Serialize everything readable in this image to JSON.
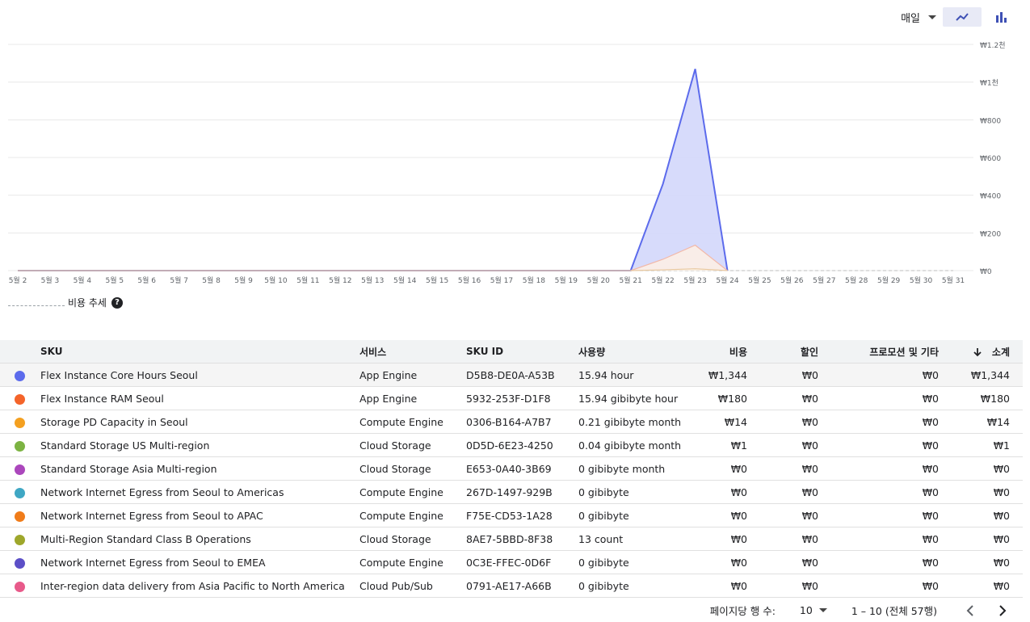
{
  "toolbar": {
    "granularity": "매일",
    "line_icon": "line-chart-icon",
    "bar_icon": "bar-chart-icon"
  },
  "legend": {
    "trend_label": "비용 추세",
    "help": "?"
  },
  "chart_data": {
    "type": "area",
    "x": [
      "5월 2",
      "5월 3",
      "5월 4",
      "5월 5",
      "5월 6",
      "5월 7",
      "5월 8",
      "5월 9",
      "5월 10",
      "5월 11",
      "5월 12",
      "5월 13",
      "5월 14",
      "5월 15",
      "5월 16",
      "5월 17",
      "5월 18",
      "5월 19",
      "5월 20",
      "5월 21",
      "5월 22",
      "5월 23",
      "5월 24",
      "5월 25",
      "5월 26",
      "5월 27",
      "5월 28",
      "5월 29",
      "5월 30",
      "5월 31"
    ],
    "y_ticks": [
      "₩0",
      "₩200",
      "₩400",
      "₩600",
      "₩800",
      "₩1천",
      "₩1.2천"
    ],
    "ylim": [
      0,
      1200
    ],
    "grid": true,
    "series": [
      {
        "values": [
          0,
          0,
          0,
          0,
          0,
          0,
          0,
          0,
          0,
          0,
          0,
          0,
          0,
          0,
          0,
          0,
          0,
          0,
          0,
          0,
          460,
          1070,
          0,
          null,
          null,
          null,
          null,
          null,
          null,
          null
        ],
        "color": "#5c6bec",
        "fill": "#d3d7fb"
      },
      {
        "values": [
          0,
          0,
          0,
          0,
          0,
          0,
          0,
          0,
          0,
          0,
          0,
          0,
          0,
          0,
          0,
          0,
          0,
          0,
          0,
          0,
          60,
          135,
          0,
          null,
          null,
          null,
          null,
          null,
          null,
          null
        ],
        "color": "#f2b8a8",
        "fill": "#fdeee6"
      },
      {
        "values": [
          0,
          0,
          0,
          0,
          0,
          0,
          0,
          0,
          0,
          0,
          0,
          0,
          0,
          0,
          0,
          0,
          0,
          0,
          0,
          0,
          4,
          10,
          0,
          null,
          null,
          null,
          null,
          null,
          null,
          null
        ],
        "color": "#e8c8a0",
        "fill": "#fbf1e4"
      }
    ],
    "trend": {
      "values": [
        0,
        0,
        0,
        0,
        0,
        0,
        0,
        0,
        0,
        0,
        0,
        0,
        0,
        0,
        0,
        0,
        0,
        0,
        0,
        0,
        0,
        0,
        0,
        0,
        0,
        0,
        0,
        0,
        0,
        0
      ],
      "color": "#bdbdbd",
      "style": "dashed"
    }
  },
  "table": {
    "headers": {
      "sku": "SKU",
      "service": "서비스",
      "sku_id": "SKU ID",
      "usage": "사용량",
      "cost": "비용",
      "discount": "할인",
      "promo": "프로모션 및 기타",
      "subtotal": "소계"
    },
    "rows": [
      {
        "color": "#5c6bec",
        "sku": "Flex Instance Core Hours Seoul",
        "service": "App Engine",
        "sku_id": "D5B8-DE0A-A53B",
        "usage": "15.94 hour",
        "cost": "₩1,344",
        "discount": "₩0",
        "promo": "₩0",
        "subtotal": "₩1,344"
      },
      {
        "color": "#f4642a",
        "sku": "Flex Instance RAM Seoul",
        "service": "App Engine",
        "sku_id": "5932-253F-D1F8",
        "usage": "15.94 gibibyte hour",
        "cost": "₩180",
        "discount": "₩0",
        "promo": "₩0",
        "subtotal": "₩180"
      },
      {
        "color": "#f4a020",
        "sku": "Storage PD Capacity in Seoul",
        "service": "Compute Engine",
        "sku_id": "0306-B164-A7B7",
        "usage": "0.21 gibibyte month",
        "cost": "₩14",
        "discount": "₩0",
        "promo": "₩0",
        "subtotal": "₩14"
      },
      {
        "color": "#7cb342",
        "sku": "Standard Storage US Multi-region",
        "service": "Cloud Storage",
        "sku_id": "0D5D-6E23-4250",
        "usage": "0.04 gibibyte month",
        "cost": "₩1",
        "discount": "₩0",
        "promo": "₩0",
        "subtotal": "₩1"
      },
      {
        "color": "#ab47bc",
        "sku": "Standard Storage Asia Multi-region",
        "service": "Cloud Storage",
        "sku_id": "E653-0A40-3B69",
        "usage": "0 gibibyte month",
        "cost": "₩0",
        "discount": "₩0",
        "promo": "₩0",
        "subtotal": "₩0"
      },
      {
        "color": "#3fa7c4",
        "sku": "Network Internet Egress from Seoul to Americas",
        "service": "Compute Engine",
        "sku_id": "267D-1497-929B",
        "usage": "0 gibibyte",
        "cost": "₩0",
        "discount": "₩0",
        "promo": "₩0",
        "subtotal": "₩0"
      },
      {
        "color": "#f07c1a",
        "sku": "Network Internet Egress from Seoul to APAC",
        "service": "Compute Engine",
        "sku_id": "F75E-CD53-1A28",
        "usage": "0 gibibyte",
        "cost": "₩0",
        "discount": "₩0",
        "promo": "₩0",
        "subtotal": "₩0"
      },
      {
        "color": "#9ea72b",
        "sku": "Multi-Region Standard Class B Operations",
        "service": "Cloud Storage",
        "sku_id": "8AE7-5BBD-8F38",
        "usage": "13 count",
        "cost": "₩0",
        "discount": "₩0",
        "promo": "₩0",
        "subtotal": "₩0"
      },
      {
        "color": "#5c4fc7",
        "sku": "Network Internet Egress from Seoul to EMEA",
        "service": "Compute Engine",
        "sku_id": "0C3E-FFEC-0D6F",
        "usage": "0 gibibyte",
        "cost": "₩0",
        "discount": "₩0",
        "promo": "₩0",
        "subtotal": "₩0"
      },
      {
        "color": "#e85a8a",
        "sku": "Inter-region data delivery from Asia Pacific to North America",
        "service": "Cloud Pub/Sub",
        "sku_id": "0791-AE17-A66B",
        "usage": "0 gibibyte",
        "cost": "₩0",
        "discount": "₩0",
        "promo": "₩0",
        "subtotal": "₩0"
      }
    ]
  },
  "pagination": {
    "rows_label": "페이지당 행 수:",
    "rows_value": "10",
    "range": "1 – 10 (전체 57행)"
  }
}
